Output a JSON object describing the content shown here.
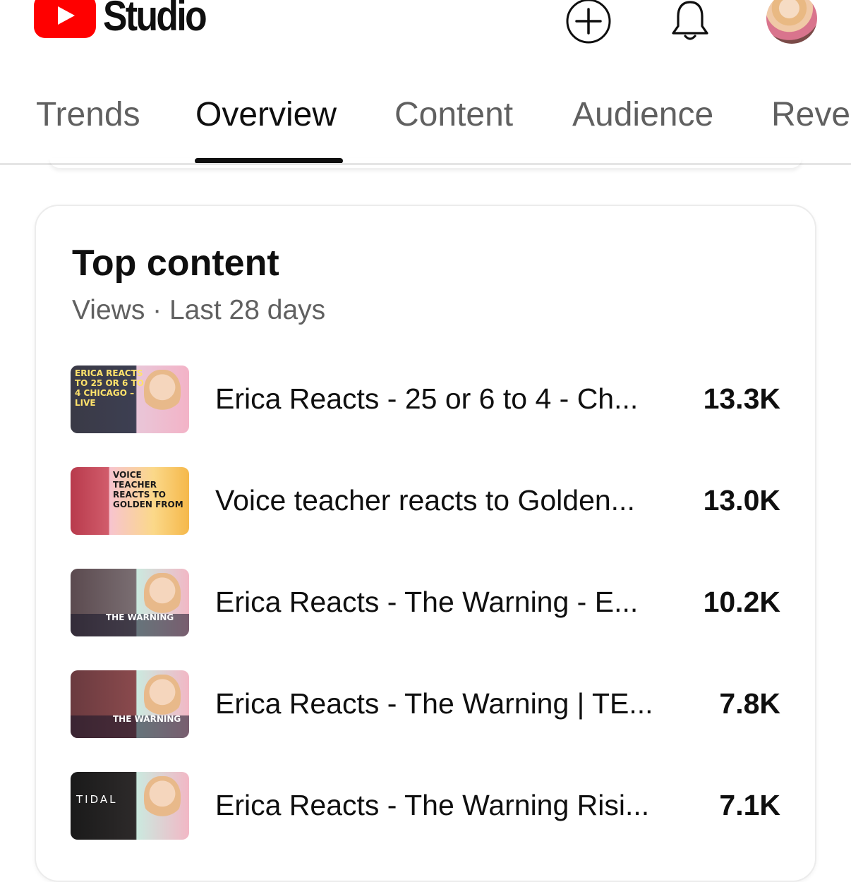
{
  "app": {
    "title": "Studio",
    "brand_color": "#ff0000"
  },
  "header": {
    "create_icon": "plus-circle-icon",
    "notifications_icon": "bell-icon",
    "avatar_icon": "user-avatar"
  },
  "tabs": [
    {
      "label": "Trends",
      "active": false
    },
    {
      "label": "Overview",
      "active": true
    },
    {
      "label": "Content",
      "active": false
    },
    {
      "label": "Audience",
      "active": false
    },
    {
      "label": "Revenue",
      "active": false
    }
  ],
  "top_content": {
    "title": "Top content",
    "subtitle": "Views · Last 28 days",
    "items": [
      {
        "title": "Erica Reacts - 25 or 6 to 4 - Ch...",
        "views": "13.3K",
        "thumb_text": "ERICA REACTS TO 25 OR 6 TO 4 CHICAGO – LIVE"
      },
      {
        "title": "Voice teacher reacts to Golden...",
        "views": "13.0K",
        "thumb_text": "VOICE TEACHER REACTS TO GOLDEN FROM"
      },
      {
        "title": "Erica Reacts - The Warning -  E...",
        "views": "10.2K",
        "thumb_text": "THE WARNING"
      },
      {
        "title": "Erica Reacts - The Warning | TE...",
        "views": "7.8K",
        "thumb_text": "THE WARNING"
      },
      {
        "title": "Erica Reacts - The Warning Risi...",
        "views": "7.1K",
        "thumb_text": "TIDAL"
      }
    ]
  }
}
